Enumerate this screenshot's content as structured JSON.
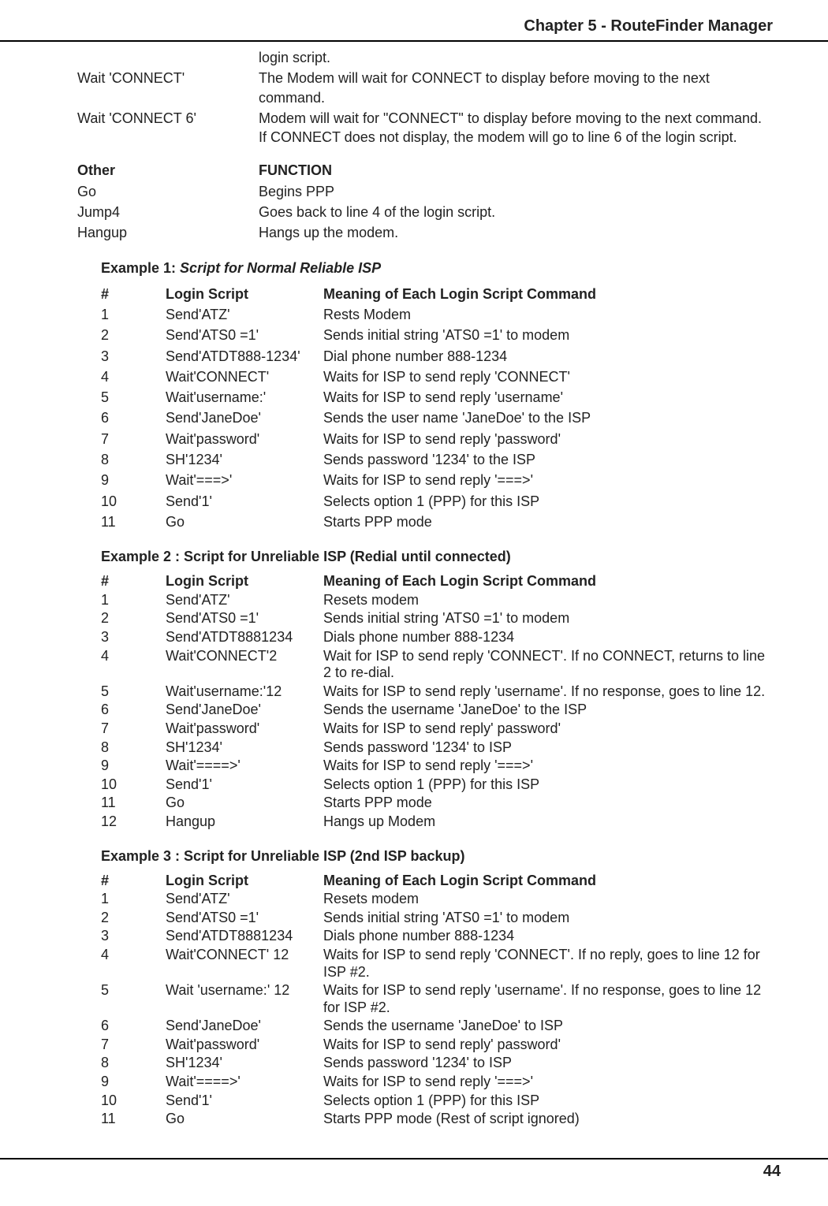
{
  "header": {
    "chapter": "Chapter 5 - RouteFinder Manager"
  },
  "intro_rows": [
    {
      "cmd": "",
      "desc": "login script."
    },
    {
      "cmd": "Wait 'CONNECT'",
      "desc": "The Modem will wait for CONNECT to display before moving to the next command."
    },
    {
      "cmd": "Wait 'CONNECT 6'",
      "desc": "Modem will wait for \"CONNECT\" to display before moving to the next command.  If CONNECT does not display, the modem will go to line 6 of the login script."
    }
  ],
  "other_header": {
    "cmd": "Other",
    "desc": "FUNCTION"
  },
  "other_rows": [
    {
      "cmd": "Go",
      "desc": "Begins PPP"
    },
    {
      "cmd": "Jump4",
      "desc": "Goes back to line 4 of the login script."
    },
    {
      "cmd": "Hangup",
      "desc": "Hangs up the modem."
    }
  ],
  "ex1": {
    "title_label": "Example 1: ",
    "title_ital": "Script for Normal Reliable ISP",
    "head": {
      "num": "#",
      "script": "Login Script",
      "mean": "Meaning of Each Login Script Command"
    },
    "rows": [
      {
        "num": "1",
        "script": "Send'ATZ'",
        "mean": "Rests Modem"
      },
      {
        "num": "2",
        "script": "Send'ATS0 =1'",
        "mean": "Sends initial string 'ATS0 =1' to modem"
      },
      {
        "num": "3",
        "script": "Send'ATDT888-1234'",
        "mean": "Dial phone number 888-1234"
      },
      {
        "num": "4",
        "script": "Wait'CONNECT'",
        "mean": "Waits for ISP to send reply 'CONNECT'"
      },
      {
        "num": "5",
        "script": "Wait'username:'",
        "mean": "Waits for ISP to send reply 'username'"
      },
      {
        "num": "6",
        "script": "Send'JaneDoe'",
        "mean": "Sends the user name 'JaneDoe' to the ISP"
      },
      {
        "num": "7",
        "script": "Wait'password'",
        "mean": "Waits for ISP to send reply 'password'"
      },
      {
        "num": "8",
        "script": "SH'1234'",
        "mean": "Sends password '1234' to the ISP"
      },
      {
        "num": "9",
        "script": "Wait'===>'",
        "mean": "Waits for ISP to send reply '===>'"
      },
      {
        "num": "10",
        "script": "Send'1'",
        "mean": "Selects option 1 (PPP) for this ISP"
      },
      {
        "num": "11",
        "script": "Go",
        "mean": "Starts PPP mode"
      }
    ]
  },
  "ex2": {
    "title": "Example 2 : Script for Unreliable ISP (Redial until connected)",
    "head": {
      "num": "#",
      "script": "Login Script",
      "mean": "Meaning of Each Login Script Command"
    },
    "rows": [
      {
        "num": "1",
        "script": "Send'ATZ'",
        "mean": "Resets modem"
      },
      {
        "num": "2",
        "script": "Send'ATS0 =1'",
        "mean": "Sends initial string 'ATS0 =1' to modem"
      },
      {
        "num": "3",
        "script": "Send'ATDT8881234",
        "mean": "Dials phone number 888-1234"
      },
      {
        "num": "4",
        "script": "Wait'CONNECT'2",
        "mean": "Wait for ISP to send reply 'CONNECT'.  If no CONNECT, returns to line 2 to re-dial."
      },
      {
        "num": "5",
        "script": "Wait'username:'12",
        "mean": "Waits for ISP to send reply 'username'.  If no response, goes to line 12."
      },
      {
        "num": "6",
        "script": "Send'JaneDoe'",
        "mean": "Sends the username 'JaneDoe' to the ISP"
      },
      {
        "num": "7",
        "script": "Wait'password'",
        "mean": "Waits for ISP to send reply' password'"
      },
      {
        "num": "8",
        "script": "SH'1234'",
        "mean": "Sends password '1234' to ISP"
      },
      {
        "num": "9",
        "script": "Wait'====>'",
        "mean": "Waits for ISP to send reply '===>'"
      },
      {
        "num": "10",
        "script": "Send'1'",
        "mean": "Selects option 1 (PPP) for this ISP"
      },
      {
        "num": "11",
        "script": "Go",
        "mean": "Starts PPP mode"
      },
      {
        "num": "12",
        "script": "Hangup",
        "mean": "Hangs up Modem"
      }
    ]
  },
  "ex3": {
    "title": "Example 3 : Script for Unreliable ISP (2nd ISP backup)",
    "head": {
      "num": "#",
      "script": "Login Script",
      "mean": "Meaning of Each Login Script Command"
    },
    "rows": [
      {
        "num": "1",
        "script": "Send'ATZ'",
        "mean": "Resets modem"
      },
      {
        "num": "2",
        "script": "Send'ATS0 =1'",
        "mean": "Sends initial string 'ATS0 =1' to modem"
      },
      {
        "num": "3",
        "script": "Send'ATDT8881234",
        "mean": "Dials phone number 888-1234"
      },
      {
        "num": "4",
        "script": "Wait'CONNECT' 12",
        "mean": "Waits for ISP to send reply 'CONNECT'.  If no reply, goes to line 12 for ISP #2."
      },
      {
        "num": "5",
        "script": "Wait 'username:' 12",
        "mean": "Waits for ISP to send reply 'username'.  If no response, goes to line 12 for ISP #2."
      },
      {
        "num": "6",
        "script": "Send'JaneDoe'",
        "mean": "Sends the username 'JaneDoe' to ISP"
      },
      {
        "num": "7",
        "script": "Wait'password'",
        "mean": "Waits for ISP to send reply' password'"
      },
      {
        "num": "8",
        "script": "SH'1234'",
        "mean": "Sends password '1234' to ISP"
      },
      {
        "num": "9",
        "script": "Wait'====>'",
        "mean": "Waits for ISP to send reply '===>'"
      },
      {
        "num": "10",
        "script": "Send'1'",
        "mean": "Selects option 1 (PPP) for this ISP"
      },
      {
        "num": "11",
        "script": "Go",
        "mean": "Starts PPP mode (Rest of script ignored)"
      }
    ]
  },
  "page_number": "44"
}
